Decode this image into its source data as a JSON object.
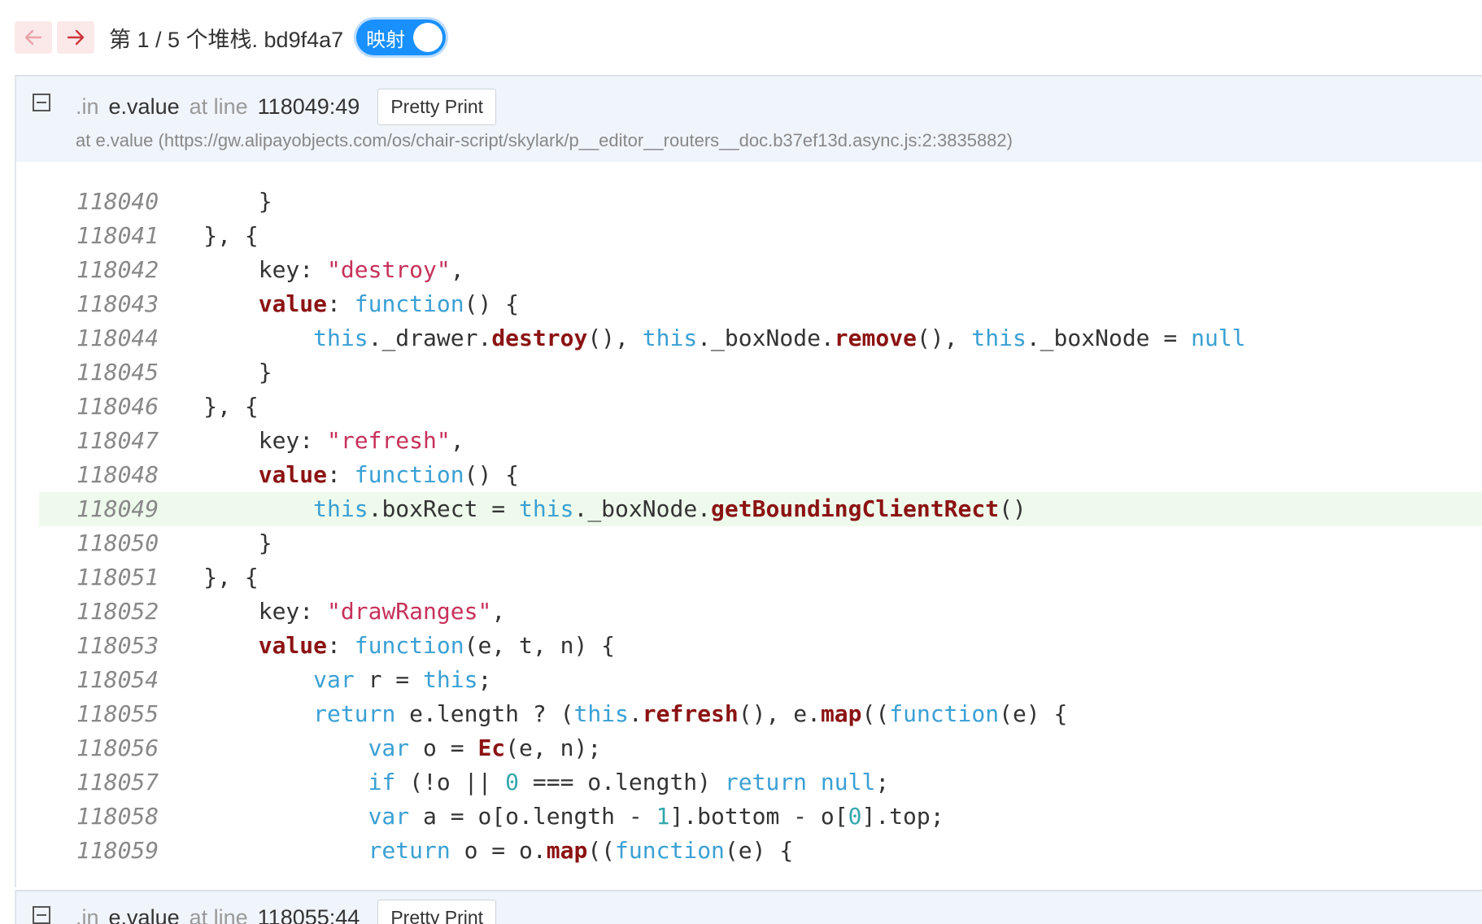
{
  "toolbar": {
    "prev_icon": "arrow-left-icon",
    "next_icon": "arrow-right-icon",
    "title": "第 1 / 5 个堆栈. bd9f4a7",
    "toggle_label": "映射",
    "toggle_on": true
  },
  "frames": [
    {
      "prefix": ".in",
      "func": "e.value",
      "at_line_label": "at line",
      "location": "118049:49",
      "pretty_print_label": "Pretty Print",
      "url": "at e.value (https://gw.alipayobjects.com/os/chair-script/skylark/p__editor__routers__doc.b37ef13d.async.js:2:3835882)",
      "highlight_line": "118049",
      "lines": [
        {
          "no": "118040",
          "code": "                }"
        },
        {
          "no": "118041",
          "code": "            }, {"
        },
        {
          "no": "118042",
          "code": "                key: \"destroy\","
        },
        {
          "no": "118043",
          "code": "                value: function() {"
        },
        {
          "no": "118044",
          "code": "                    this._drawer.destroy(), this._boxNode.remove(), this._boxNode = null"
        },
        {
          "no": "118045",
          "code": "                }"
        },
        {
          "no": "118046",
          "code": "            }, {"
        },
        {
          "no": "118047",
          "code": "                key: \"refresh\","
        },
        {
          "no": "118048",
          "code": "                value: function() {"
        },
        {
          "no": "118049",
          "code": "                    this.boxRect = this._boxNode.getBoundingClientRect()"
        },
        {
          "no": "118050",
          "code": "                }"
        },
        {
          "no": "118051",
          "code": "            }, {"
        },
        {
          "no": "118052",
          "code": "                key: \"drawRanges\","
        },
        {
          "no": "118053",
          "code": "                value: function(e, t, n) {"
        },
        {
          "no": "118054",
          "code": "                    var r = this;"
        },
        {
          "no": "118055",
          "code": "                    return e.length ? (this.refresh(), e.map((function(e) {"
        },
        {
          "no": "118056",
          "code": "                        var o = Ec(e, n);"
        },
        {
          "no": "118057",
          "code": "                        if (!o || 0 === o.length) return null;"
        },
        {
          "no": "118058",
          "code": "                        var a = o[o.length - 1].bottom - o[0].top;"
        },
        {
          "no": "118059",
          "code": "                        return o = o.map((function(e) {"
        }
      ]
    },
    {
      "prefix": ".in",
      "func": "e.value",
      "at_line_label": "at line",
      "location": "118055:44",
      "pretty_print_label": "Pretty Print"
    }
  ],
  "colors": {
    "keyword": "#3aa0d4",
    "bold_keyword": "#8c1313",
    "string": "#c7315a",
    "number": "#34a7ae",
    "highlight_bg": "#eefbec",
    "header_bg": "#f0f4fb",
    "toggle": "#1890ff"
  }
}
